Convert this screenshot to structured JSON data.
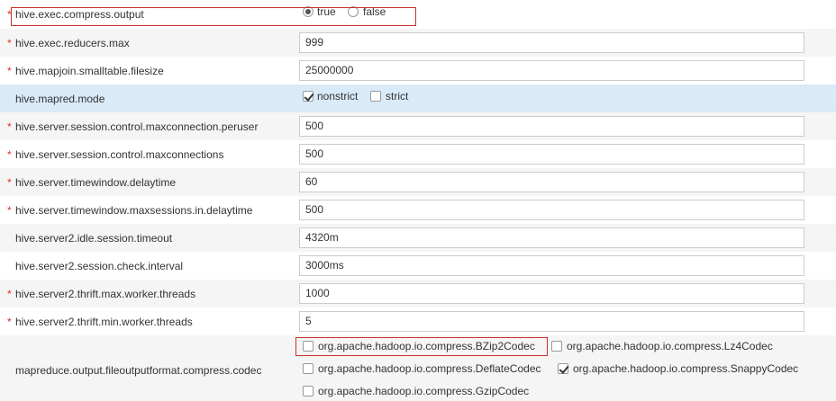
{
  "rows": [
    {
      "name": "hive.exec.compress.output",
      "required": true,
      "type": "radio",
      "options": [
        "true",
        "false"
      ],
      "selected": "true"
    },
    {
      "name": "hive.exec.reducers.max",
      "required": true,
      "type": "text",
      "value": "999"
    },
    {
      "name": "hive.mapjoin.smalltable.filesize",
      "required": true,
      "type": "text",
      "value": "25000000"
    },
    {
      "name": "hive.mapred.mode",
      "required": false,
      "type": "checkbox",
      "options": [
        "nonstrict",
        "strict"
      ],
      "checked": [
        "nonstrict"
      ]
    },
    {
      "name": "hive.server.session.control.maxconnection.peruser",
      "required": true,
      "type": "text",
      "value": "500"
    },
    {
      "name": "hive.server.session.control.maxconnections",
      "required": true,
      "type": "text",
      "value": "500"
    },
    {
      "name": "hive.server.timewindow.delaytime",
      "required": true,
      "type": "text",
      "value": "60"
    },
    {
      "name": "hive.server.timewindow.maxsessions.in.delaytime",
      "required": true,
      "type": "text",
      "value": "500"
    },
    {
      "name": "hive.server2.idle.session.timeout",
      "required": false,
      "type": "text",
      "value": "4320m"
    },
    {
      "name": "hive.server2.session.check.interval",
      "required": false,
      "type": "text",
      "value": "3000ms"
    },
    {
      "name": "hive.server2.thrift.max.worker.threads",
      "required": true,
      "type": "text",
      "value": "1000"
    },
    {
      "name": "hive.server2.thrift.min.worker.threads",
      "required": true,
      "type": "text",
      "value": "5"
    }
  ],
  "codec": {
    "name": "mapreduce.output.fileoutputformat.compress.codec",
    "options": [
      {
        "label": "org.apache.hadoop.io.compress.BZip2Codec",
        "checked": false
      },
      {
        "label": "org.apache.hadoop.io.compress.Lz4Codec",
        "checked": false
      },
      {
        "label": "org.apache.hadoop.io.compress.DeflateCodec",
        "checked": false
      },
      {
        "label": "org.apache.hadoop.io.compress.SnappyCodec",
        "checked": true
      },
      {
        "label": "org.apache.hadoop.io.compress.GzipCodec",
        "checked": false
      }
    ]
  },
  "colors": {
    "highlight_row": "#d9eaf8",
    "required_star": "#d9312b",
    "annotation_box": "#c9302c"
  },
  "required_mark": "*"
}
